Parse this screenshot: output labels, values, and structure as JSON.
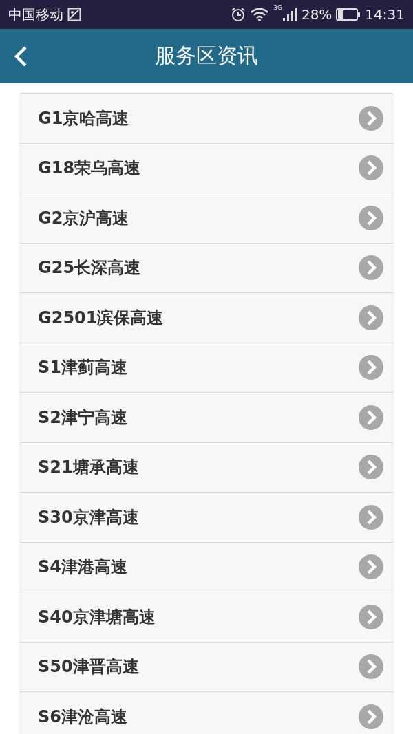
{
  "status_bar": {
    "carrier": "中国移动",
    "network": "3G",
    "battery": "28%",
    "time": "14:31"
  },
  "header": {
    "title": "服务区资讯"
  },
  "highways": [
    {
      "label": "G1京哈高速"
    },
    {
      "label": "G18荣乌高速"
    },
    {
      "label": "G2京沪高速"
    },
    {
      "label": "G25长深高速"
    },
    {
      "label": "G2501滨保高速"
    },
    {
      "label": "S1津蓟高速"
    },
    {
      "label": "S2津宁高速"
    },
    {
      "label": "S21塘承高速"
    },
    {
      "label": "S30京津高速"
    },
    {
      "label": "S4津港高速"
    },
    {
      "label": "S40京津塘高速"
    },
    {
      "label": "S50津晋高速"
    },
    {
      "label": "S6津沧高速"
    }
  ]
}
